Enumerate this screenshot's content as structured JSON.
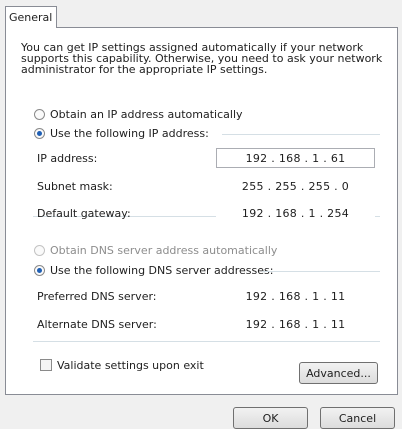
{
  "tab": {
    "label": "General"
  },
  "intro": "You can get IP settings assigned automatically if your network supports this capability. Otherwise, you need to ask your network administrator for the appropriate IP settings.",
  "ip_mode": {
    "auto_label": "Obtain an IP address automatically",
    "manual_label": "Use the following IP address:",
    "selected": "manual"
  },
  "ip_fields": [
    {
      "label": "IP address:",
      "value": "192 . 168 .  1  .  61"
    },
    {
      "label": "Subnet mask:",
      "value": "255 . 255 . 255 .  0"
    },
    {
      "label": "Default gateway:",
      "value": "192 . 168 .  1  . 254"
    }
  ],
  "dns_mode": {
    "auto_label": "Obtain DNS server address automatically",
    "manual_label": "Use the following DNS server addresses:",
    "selected": "manual"
  },
  "dns_fields": [
    {
      "label": "Preferred DNS server:",
      "value": "192 . 168 .  1  .  11"
    },
    {
      "label": "Alternate DNS server:",
      "value": "192 . 168 .  1  .  11"
    }
  ],
  "validate": {
    "label": "Validate settings upon exit",
    "checked": false
  },
  "buttons": {
    "advanced": "Advanced...",
    "ok": "OK",
    "cancel": "Cancel"
  },
  "colors": {
    "radio_selected": "#1f5fb4",
    "border": "#898c95",
    "group_line": "#d5dfe5"
  }
}
